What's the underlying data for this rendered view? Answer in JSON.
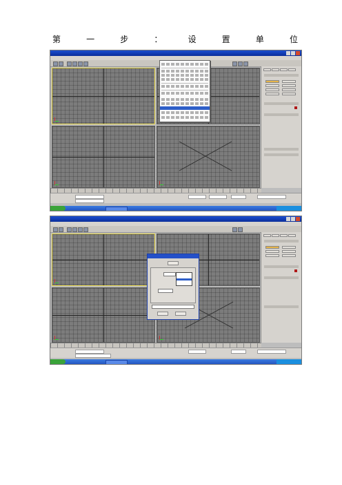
{
  "heading": {
    "chars": [
      "第",
      "一",
      "步",
      "：",
      "设",
      "置",
      "单",
      "位"
    ]
  },
  "colors": {
    "title_bar": "#1c4fd0",
    "viewport": "#7c7c7c",
    "active_viewport_border": "#e8d84a",
    "menu_highlight": "#2f5fc8",
    "selected_command": "#e7b54a",
    "taskbar": "#2456c2",
    "start_button": "#3aa33a"
  },
  "screenshot_1": {
    "icons": [
      "dropdown-menu-icon",
      "viewport-grid-icon",
      "command-panel-icon",
      "windows-taskbar-icon"
    ]
  },
  "screenshot_2": {
    "icons": [
      "units-setup-dialog-icon",
      "viewport-grid-icon",
      "command-panel-icon",
      "windows-taskbar-icon"
    ]
  }
}
